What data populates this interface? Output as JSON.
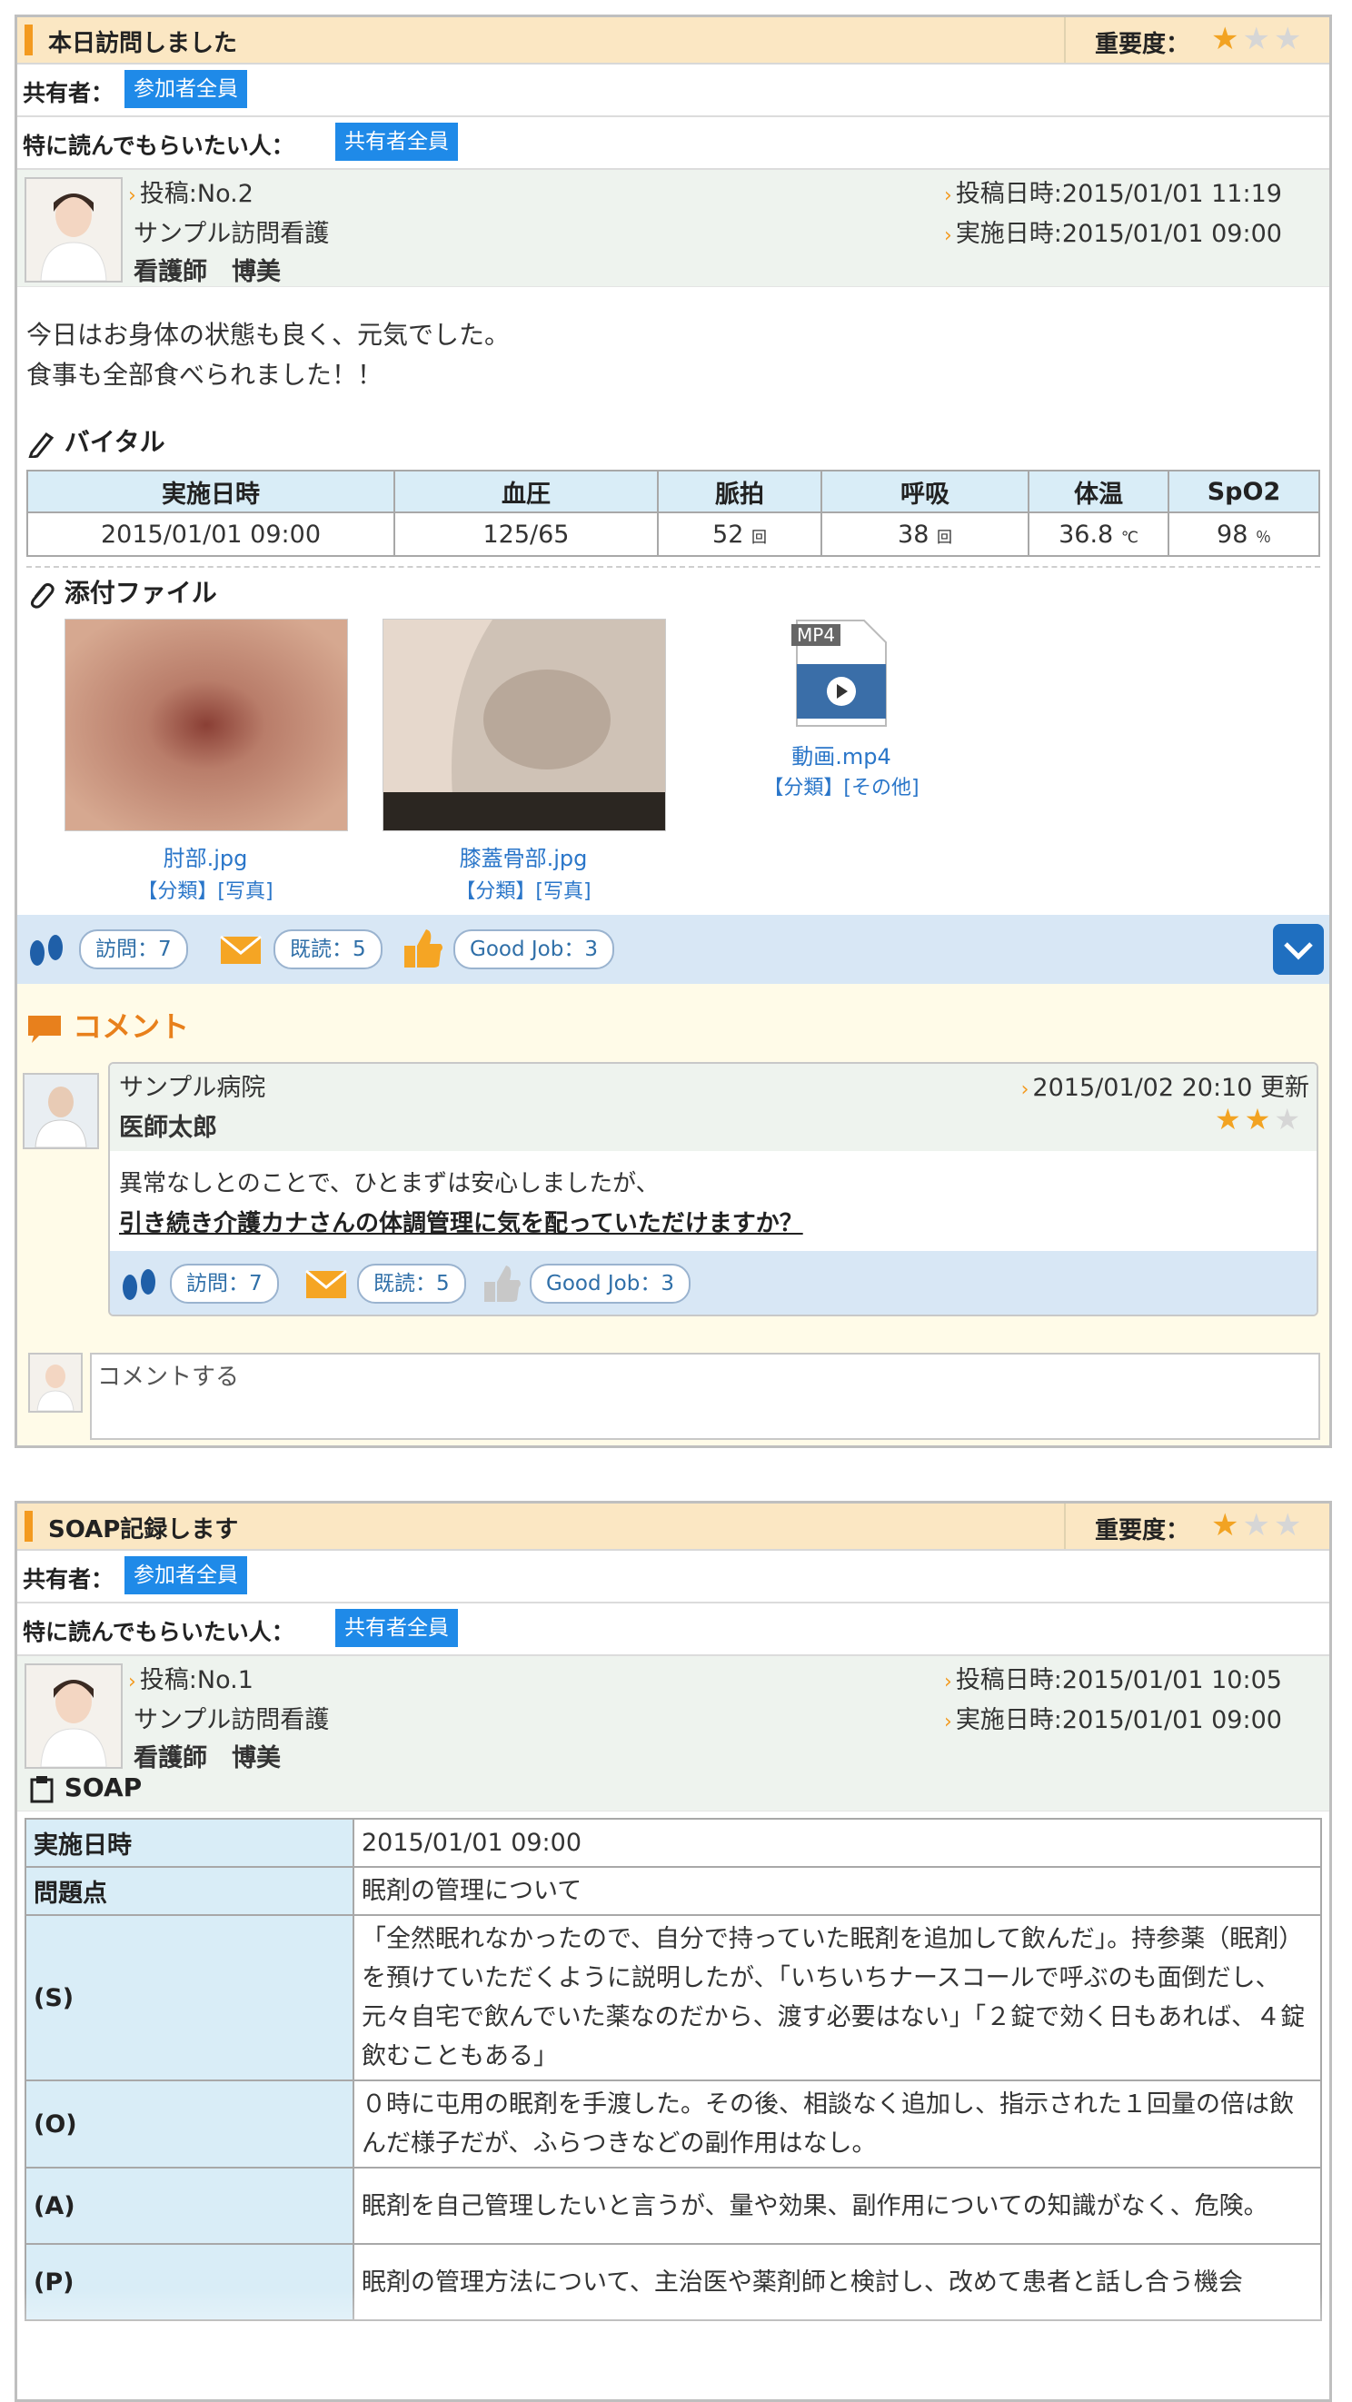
{
  "post1": {
    "title": "本日訪問しました",
    "importance_label": "重要度：",
    "stars": [
      "★",
      "★",
      "★"
    ],
    "share_label": "共有者：",
    "share_value": "参加者全員",
    "read_label": "特に読んでもらいたい人：",
    "read_value": "共有者全員",
    "post_no": "投稿:No.2",
    "org": "サンプル訪問看護",
    "author": "看護師　博美",
    "posted_at": "投稿日時:2015/01/01 11:19",
    "done_at": "実施日時:2015/01/01 09:00",
    "body_line1": "今日はお身体の状態も良く、元気でした。",
    "body_line2": "食事も全部食べられました！！",
    "vitals_title": "バイタル",
    "vitals_headers": [
      "実施日時",
      "血圧",
      "脈拍",
      "呼吸",
      "体温",
      "SpO2"
    ],
    "vitals_values": [
      "2015/01/01 09:00",
      "125/65",
      "52",
      "38",
      "36.8",
      "98"
    ],
    "vitals_units": [
      "回",
      "回",
      "℃",
      "％"
    ],
    "attach_title": "添付ファイル",
    "files": [
      {
        "name": "肘部.jpg",
        "cat": "【分類】[写真]"
      },
      {
        "name": "膝蓋骨部.jpg",
        "cat": "【分類】[写真]"
      },
      {
        "name": "動画.mp4",
        "cat": "【分類】[その他]",
        "badge": "MP4"
      }
    ],
    "visit": "訪問：7",
    "read": "既読：5",
    "goodjob": "Good Job：3",
    "comment_title": "コメント",
    "comment": {
      "org": "サンプル病院",
      "author": "医師太郎",
      "updated": "2015/01/02 20:10 更新",
      "stars": [
        "★",
        "★",
        "★"
      ],
      "line1": "異常なしとのことで、ひとまずは安心しましたが、",
      "line2": "引き続き介護カナさんの体調管理に気を配っていただけますか？",
      "visit": "訪問：7",
      "read": "既読：5",
      "goodjob": "Good Job：3"
    },
    "comment_placeholder": "コメントする"
  },
  "post2": {
    "title": "SOAP記録します",
    "importance_label": "重要度：",
    "stars": [
      "★",
      "★",
      "★"
    ],
    "share_label": "共有者：",
    "share_value": "参加者全員",
    "read_label": "特に読んでもらいたい人：",
    "read_value": "共有者全員",
    "post_no": "投稿:No.1",
    "org": "サンプル訪問看護",
    "author": "看護師　博美",
    "posted_at": "投稿日時:2015/01/01 10:05",
    "done_at": "実施日時:2015/01/01 09:00",
    "soap_title": "SOAP",
    "soap_rows": [
      {
        "h": "実施日時",
        "v": "2015/01/01 09:00"
      },
      {
        "h": "問題点",
        "v": "眠剤の管理について"
      },
      {
        "h": "(S)",
        "v": "「全然眠れなかったので、自分で持っていた眠剤を追加して飲んだ」。持参薬（眠剤）を預けていただくように説明したが、「いちいちナースコールで呼ぶのも面倒だし、元々自宅で飲んでいた薬なのだから、渡す必要はない」「２錠で効く日もあれば、４錠飲むこともある」"
      },
      {
        "h": "(O)",
        "v": "０時に屯用の眠剤を手渡した。その後、相談なく追加し、指示された１回量の倍は飲んだ様子だが、ふらつきなどの副作用はなし。"
      },
      {
        "h": "(A)",
        "v": "眠剤を自己管理したいと言うが、量や効果、副作用についての知識がなく、危険。"
      },
      {
        "h": "(P)",
        "v": "眠剤の管理方法について、主治医や薬剤師と検討し、改めて患者と話し合う機会"
      }
    ]
  }
}
